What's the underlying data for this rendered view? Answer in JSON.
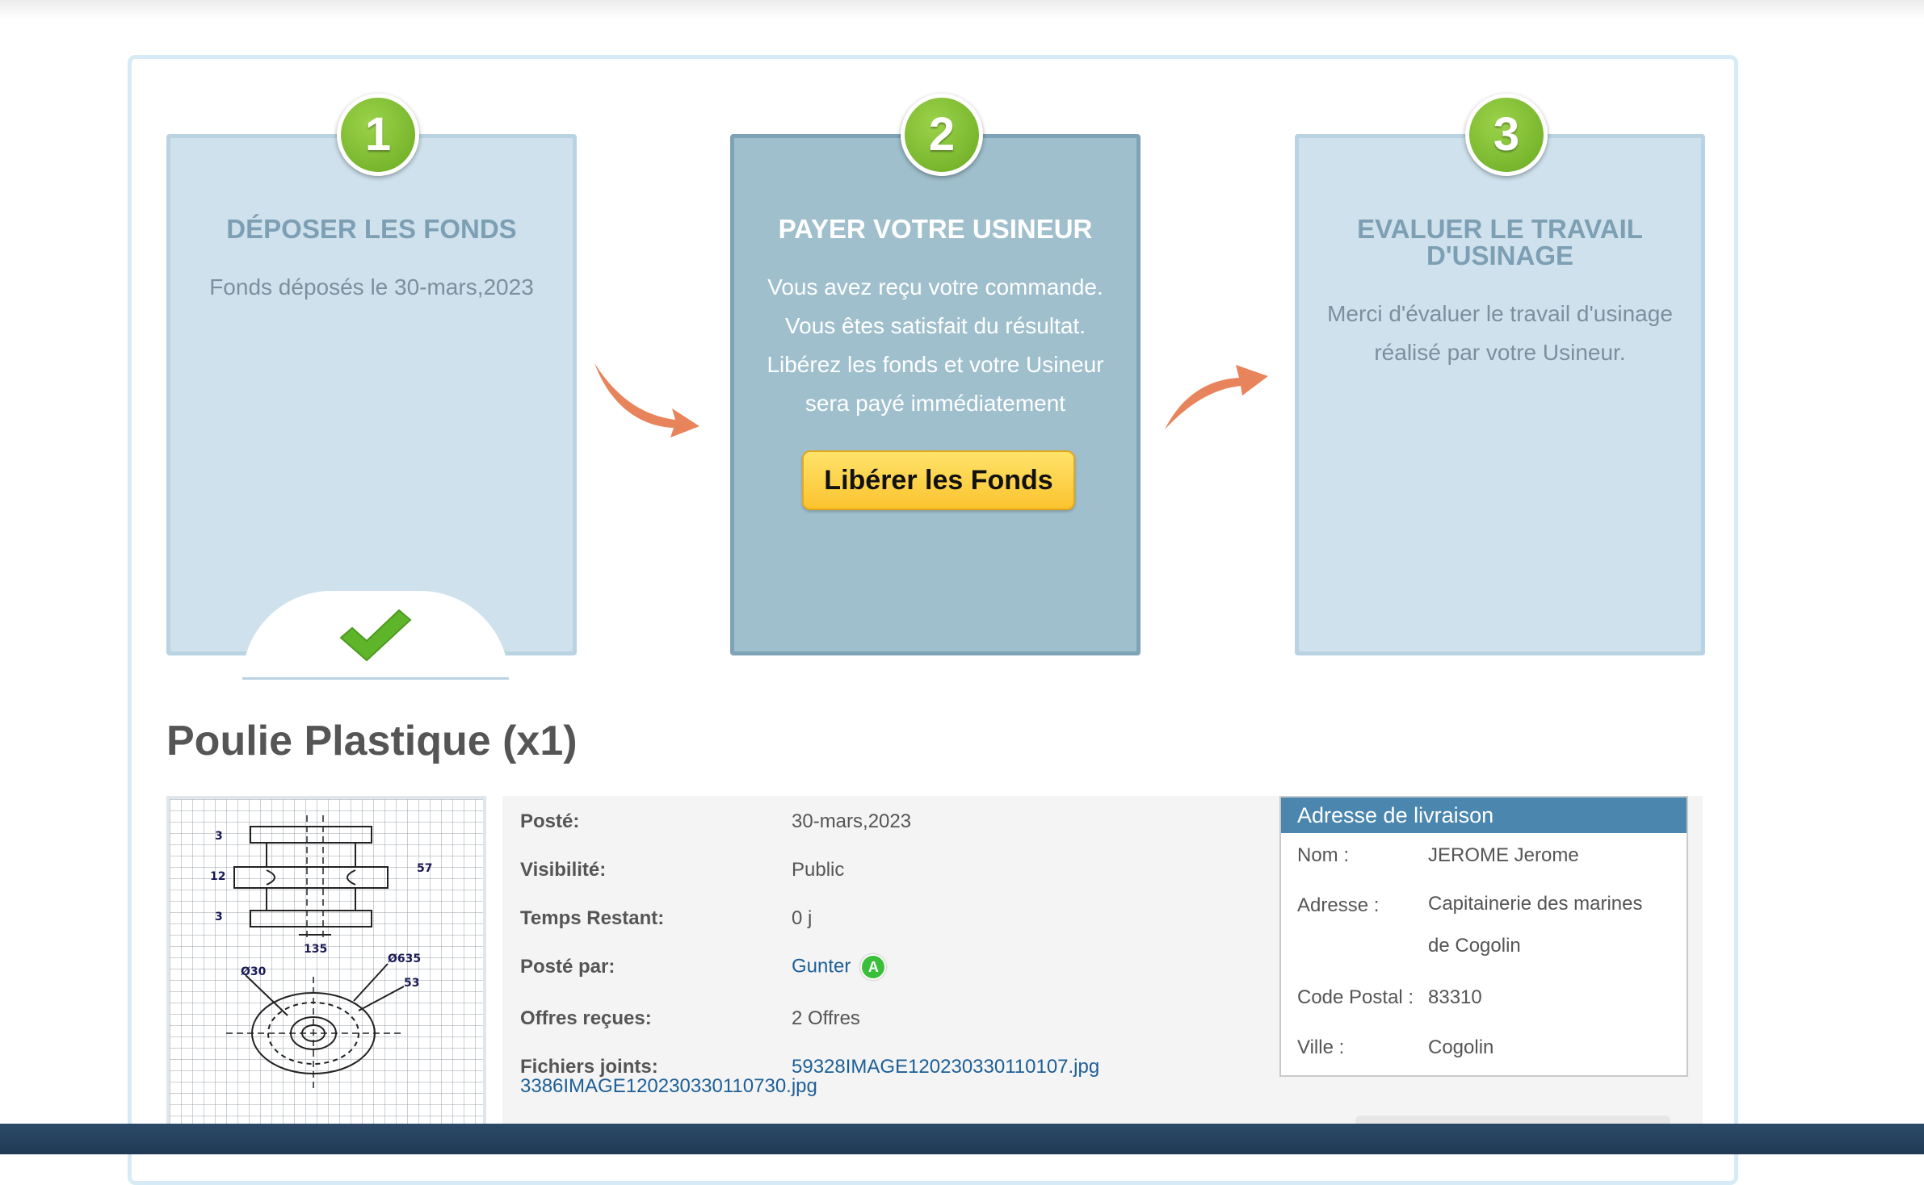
{
  "steps": [
    {
      "number": "1",
      "title": "DÉPOSER LES FONDS",
      "desc": "Fonds déposés le 30-mars,2023"
    },
    {
      "number": "2",
      "title": "PAYER VOTRE USINEUR",
      "desc": [
        "Vous avez reçu votre commande.",
        "Vous êtes satisfait du résultat.",
        "Libérez les fonds et votre Usineur",
        "sera payé immédiatement"
      ],
      "button": "Libérer les Fonds"
    },
    {
      "number": "3",
      "title": [
        "EVALUER LE TRAVAIL",
        "D'USINAGE"
      ],
      "desc": [
        "Merci d'évaluer le travail d'usinage",
        "réalisé par votre Usineur."
      ]
    }
  ],
  "project": {
    "title": "Poulie Plastique (x1)",
    "drawing_labels": [
      "3",
      "12",
      "3",
      "57",
      "135",
      "Ø30",
      "Ø635",
      "53"
    ],
    "details": [
      {
        "label": "Posté:",
        "value": "30-mars,2023"
      },
      {
        "label": "Visibilité:",
        "value": "Public"
      },
      {
        "label": "Temps Restant:",
        "value": "0 j"
      },
      {
        "label": "Posté par:",
        "value": "Gunter",
        "badge": "A"
      },
      {
        "label": "Offres reçues:",
        "value": "2 Offres"
      },
      {
        "label": "Fichiers joints:",
        "files": [
          "59328IMAGE120230330110107.jpg",
          "3386IMAGE120230330110730.jpg"
        ]
      }
    ]
  },
  "shipping": {
    "title": "Adresse de livraison",
    "rows": [
      {
        "label": "Nom :",
        "value": [
          "JEROME Jerome"
        ]
      },
      {
        "label": "Adresse :",
        "value": [
          "Capitainerie des marines",
          "de Cogolin"
        ]
      },
      {
        "label": "Code Postal :",
        "value": [
          "83310"
        ]
      },
      {
        "label": "Ville :",
        "value": [
          "Cogolin"
        ]
      }
    ]
  },
  "colors": {
    "accent_green": "#7cc034",
    "step_active": "#9fbfcd",
    "step_inactive": "#cee1ec",
    "button_yellow": "#fbc32f",
    "header_blue": "#4a86ae",
    "link_blue": "#1d5f97"
  }
}
